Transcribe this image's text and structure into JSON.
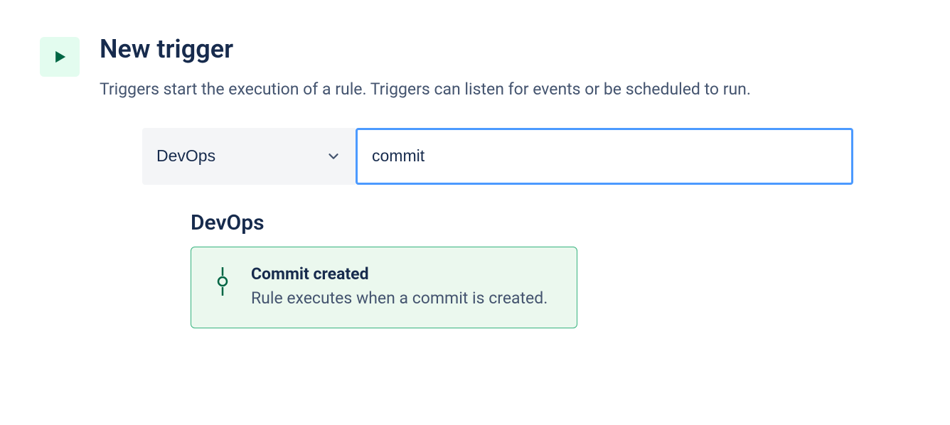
{
  "header": {
    "title": "New trigger",
    "description": "Triggers start the execution of a rule. Triggers can listen for events or be scheduled to run."
  },
  "filter": {
    "category_label": "DevOps",
    "search_value": "commit"
  },
  "results": {
    "section_heading": "DevOps",
    "items": [
      {
        "title": "Commit created",
        "description": "Rule executes when a commit is created."
      }
    ]
  }
}
